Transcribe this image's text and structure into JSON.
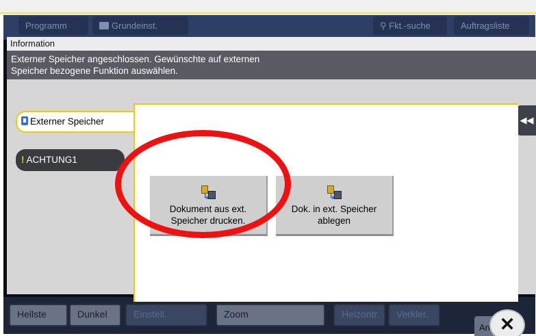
{
  "background": {
    "tabs": [
      {
        "label": "Programm"
      },
      {
        "label": "Grundeinst.",
        "icon": "settings-icon"
      },
      {
        "label": "Fkt.-suche",
        "icon": "search-icon"
      },
      {
        "label": "Auftragsliste"
      }
    ],
    "bottom_buttons": [
      "Hellste",
      "Dunkel",
      "Einstell.",
      "Zoom",
      "Heizontr.",
      "Verkler.",
      "An"
    ]
  },
  "dialog": {
    "title": "Information",
    "message_line1": "Externer Speicher angeschlossen. Gewünschte auf externen",
    "message_line2": "Speicher bezogene Funktion auswählen.",
    "collapse_symbol": "◀◀",
    "side_tabs": [
      {
        "label": "Externer Speicher",
        "active": true,
        "icon": "usb-icon"
      },
      {
        "label": "ACHTUNG1",
        "active": false,
        "icon": "warning-icon"
      }
    ],
    "functions": [
      {
        "line1": "Dokument aus ext.",
        "line2": "Speicher drucken.",
        "icon": "print-from-external-icon"
      },
      {
        "line1": "Dok. in ext. Speicher",
        "line2": "ablegen",
        "icon": "save-to-external-icon"
      }
    ],
    "close_symbol": "✕"
  },
  "colors": {
    "accent_yellow": "#f2cc00",
    "annotation_red": "#ef1010",
    "message_bar": "#595a62"
  }
}
